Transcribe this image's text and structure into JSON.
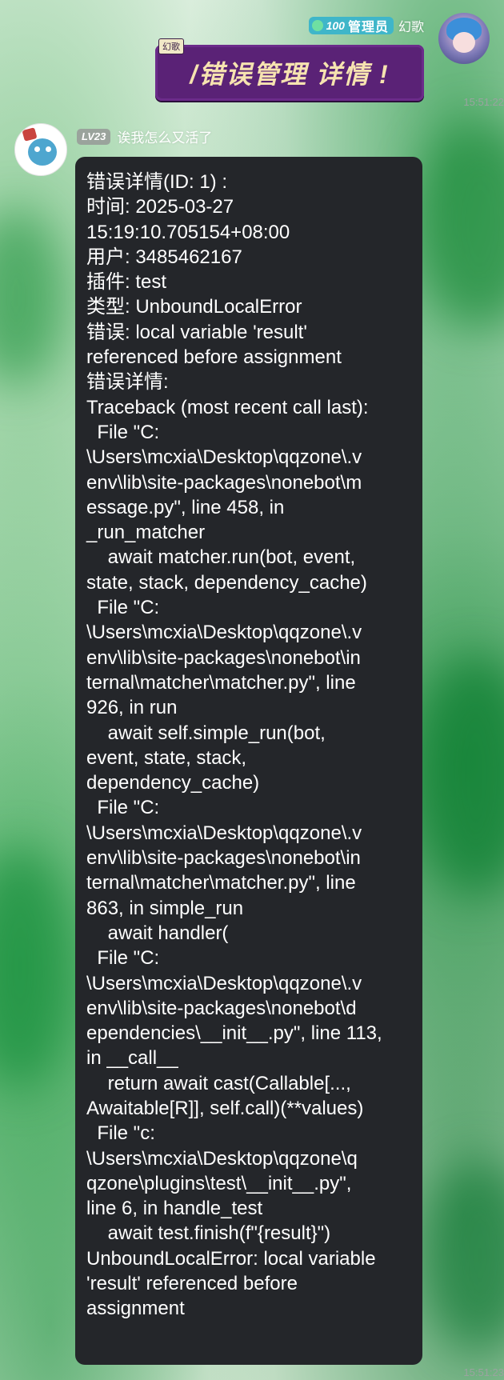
{
  "outgoing": {
    "level": "100",
    "role": "管理员",
    "name": "幻歌",
    "sticker_tag": "幻歌",
    "sticker_text": "/错误管理 详情 !",
    "time": "15:51:22"
  },
  "incoming": {
    "level": "LV23",
    "name": "诶我怎么又活了",
    "message_lines": [
      "错误详情(ID: 1) :",
      "时间: 2025-03-27",
      "15:19:10.705154+08:00",
      "用户: 3485462167",
      "插件: test",
      "类型: UnboundLocalError",
      "错误: local variable 'result'",
      "referenced before assignment",
      "错误详情:",
      "Traceback (most recent call last):",
      "  File \"C:",
      "\\Users\\mcxia\\Desktop\\qqzone\\.v",
      "env\\lib\\site-packages\\nonebot\\m",
      "essage.py\", line 458, in",
      "_run_matcher",
      "    await matcher.run(bot, event,",
      "state, stack, dependency_cache)",
      "  File \"C:",
      "\\Users\\mcxia\\Desktop\\qqzone\\.v",
      "env\\lib\\site-packages\\nonebot\\in",
      "ternal\\matcher\\matcher.py\", line",
      "926, in run",
      "    await self.simple_run(bot,",
      "event, state, stack,",
      "dependency_cache)",
      "  File \"C:",
      "\\Users\\mcxia\\Desktop\\qqzone\\.v",
      "env\\lib\\site-packages\\nonebot\\in",
      "ternal\\matcher\\matcher.py\", line",
      "863, in simple_run",
      "    await handler(",
      "  File \"C:",
      "\\Users\\mcxia\\Desktop\\qqzone\\.v",
      "env\\lib\\site-packages\\nonebot\\d",
      "ependencies\\__init__.py\", line 113,",
      "in __call__",
      "    return await cast(Callable[...,",
      "Awaitable[R]], self.call)(**values)",
      "  File \"c:",
      "\\Users\\mcxia\\Desktop\\qqzone\\q",
      "qzone\\plugins\\test\\__init__.py\",",
      "line 6, in handle_test",
      "    await test.finish(f\"{result}\")",
      "UnboundLocalError: local variable",
      "'result' referenced before",
      "assignment"
    ],
    "time": "15:51:23"
  },
  "colors": {
    "bubble_bg": "#24262a",
    "bubble_text": "#ffffff",
    "level_badge": "#3fb6c9",
    "lv_badge": "#9aa39c",
    "sticker_bg": "#5a2276",
    "sticker_text": "#f6e3b0"
  }
}
